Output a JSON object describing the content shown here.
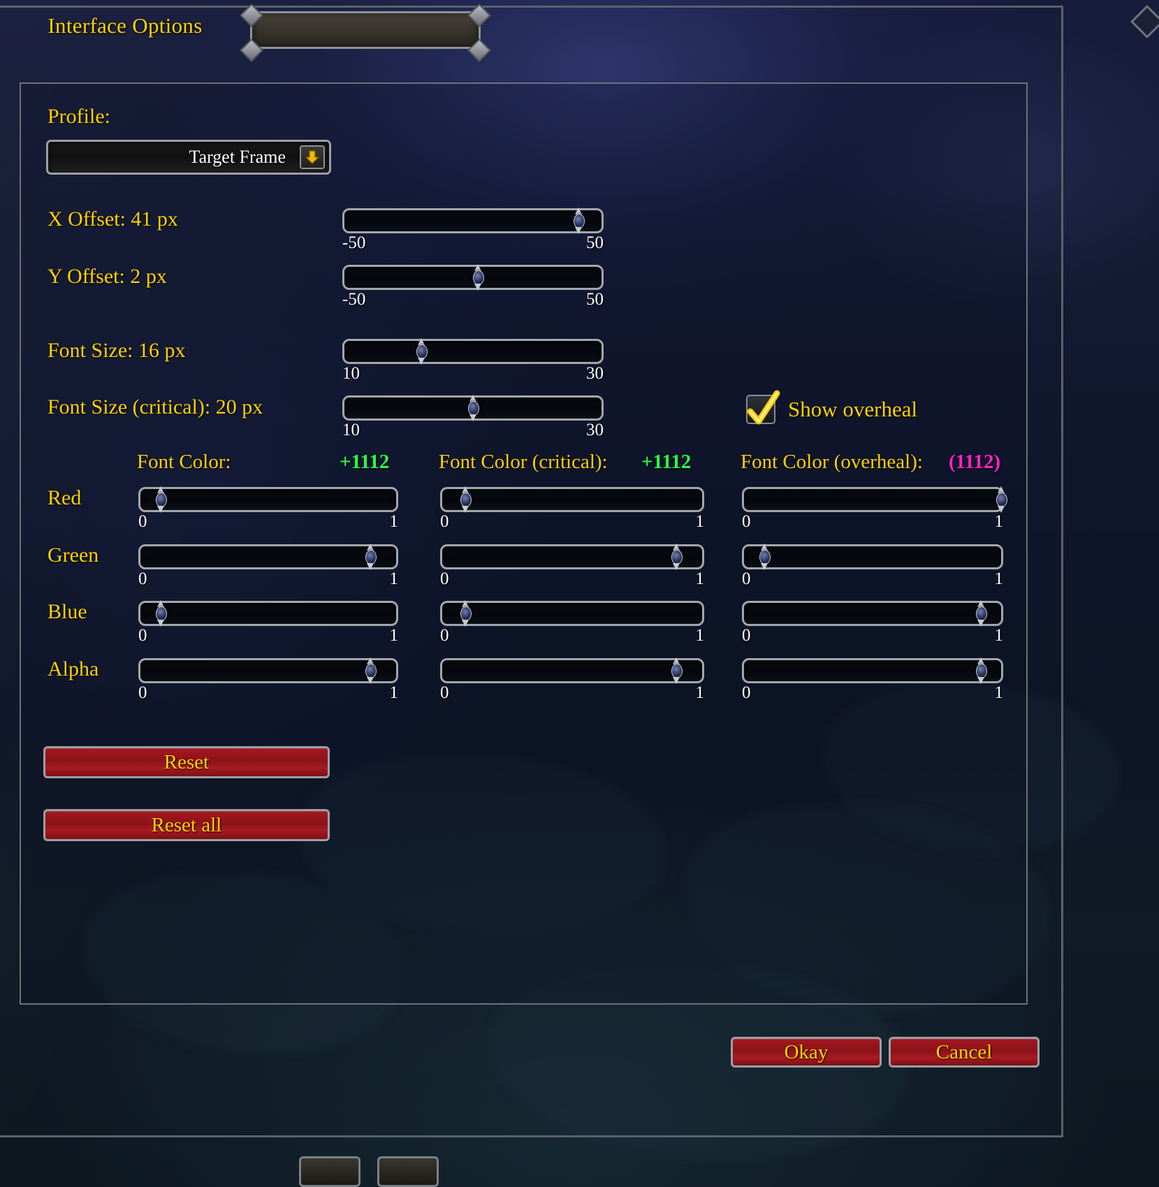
{
  "window": {
    "title": "Interface Options"
  },
  "profile": {
    "label": "Profile:",
    "selected": "Target Frame",
    "arrow_icon": "chevron-down-icon"
  },
  "sliders": {
    "x_offset": {
      "label": "X Offset: 41 px",
      "min": "-50",
      "max": "50",
      "value": 41,
      "min_val": -50,
      "max_val": 50
    },
    "y_offset": {
      "label": "Y Offset: 2 px",
      "min": "-50",
      "max": "50",
      "value": 2,
      "min_val": -50,
      "max_val": 50
    },
    "font_size": {
      "label": "Font Size: 16 px",
      "min": "10",
      "max": "30",
      "value": 16,
      "min_val": 10,
      "max_val": 30
    },
    "font_size_critical": {
      "label": "Font Size (critical): 20 px",
      "min": "10",
      "max": "30",
      "value": 20,
      "min_val": 10,
      "max_val": 30
    }
  },
  "overheal": {
    "label": "Show overheal",
    "checked": true,
    "check_icon": "checkmark-icon"
  },
  "color_columns": [
    {
      "header": "Font Color:",
      "preview_text": "+1112",
      "preview_color": "#2bff48",
      "channels": [
        {
          "name": "Red",
          "value": 0.08,
          "min": "0",
          "max": "1"
        },
        {
          "name": "Green",
          "value": 0.9,
          "min": "0",
          "max": "1"
        },
        {
          "name": "Blue",
          "value": 0.08,
          "min": "0",
          "max": "1"
        },
        {
          "name": "Alpha",
          "value": 0.9,
          "min": "0",
          "max": "1"
        }
      ]
    },
    {
      "header": "Font Color (critical):",
      "preview_text": "+1112",
      "preview_color": "#2bff48",
      "channels": [
        {
          "name": "Red",
          "value": 0.09,
          "min": "0",
          "max": "1"
        },
        {
          "name": "Green",
          "value": 0.9,
          "min": "0",
          "max": "1"
        },
        {
          "name": "Blue",
          "value": 0.09,
          "min": "0",
          "max": "1"
        },
        {
          "name": "Alpha",
          "value": 0.9,
          "min": "0",
          "max": "1"
        }
      ]
    },
    {
      "header": "Font Color (overheal):",
      "preview_text": "(1112)",
      "preview_color": "#ff22cc",
      "channels": [
        {
          "name": "Red",
          "value": 1.0,
          "min": "0",
          "max": "1"
        },
        {
          "name": "Green",
          "value": 0.08,
          "min": "0",
          "max": "1"
        },
        {
          "name": "Blue",
          "value": 0.92,
          "min": "0",
          "max": "1"
        },
        {
          "name": "Alpha",
          "value": 0.92,
          "min": "0",
          "max": "1"
        }
      ]
    }
  ],
  "channel_labels": [
    "Red",
    "Green",
    "Blue",
    "Alpha"
  ],
  "buttons": {
    "reset": "Reset",
    "reset_all": "Reset all",
    "okay": "Okay",
    "cancel": "Cancel"
  },
  "colors": {
    "gold": "#ffd100",
    "button_red": "#a41820",
    "green_preview": "#2bff48",
    "magenta_preview": "#ff22cc"
  }
}
